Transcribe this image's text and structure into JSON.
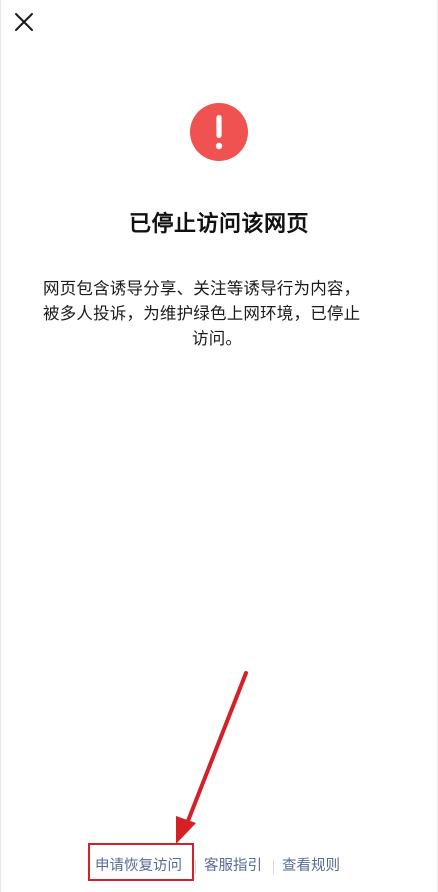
{
  "toolbar": {
    "close_icon": "close-icon"
  },
  "status": {
    "icon": "exclamation-circle-icon",
    "icon_color": "#f05252",
    "glyph": "!"
  },
  "title": "已停止访问该网页",
  "description": {
    "lines": [
      "网页包含诱导分享、关注等诱导行为内容，",
      "被多人投诉，为维护绿色上网环境，已停止",
      "访问。"
    ]
  },
  "footer_links": [
    {
      "label": "申请恢复访问"
    },
    {
      "label": "客服指引"
    },
    {
      "label": "查看规则"
    }
  ],
  "annotation": {
    "color": "#d42026"
  },
  "colors": {
    "link": "#576b95",
    "title": "#111111"
  }
}
